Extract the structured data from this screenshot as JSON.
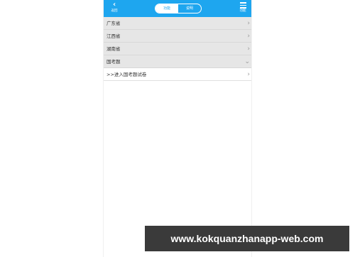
{
  "header": {
    "back_label": "返回",
    "tabs": [
      {
        "label": "功能",
        "active": true
      },
      {
        "label": "说明",
        "active": false
      }
    ],
    "menu_label": "功能"
  },
  "list": {
    "rows": [
      {
        "label": "广东省",
        "arrow": "›"
      },
      {
        "label": "江西省",
        "arrow": "›"
      },
      {
        "label": "湖南省",
        "arrow": "›"
      },
      {
        "label": "国考题",
        "arrow": "⌄"
      },
      {
        "label": ">>进入国考题试卷",
        "arrow": "›"
      }
    ]
  },
  "watermark": "www.kokquanzhanapp-web.com",
  "colors": {
    "accent": "#1ea6ef",
    "row_bg": "#e6e6e6"
  }
}
